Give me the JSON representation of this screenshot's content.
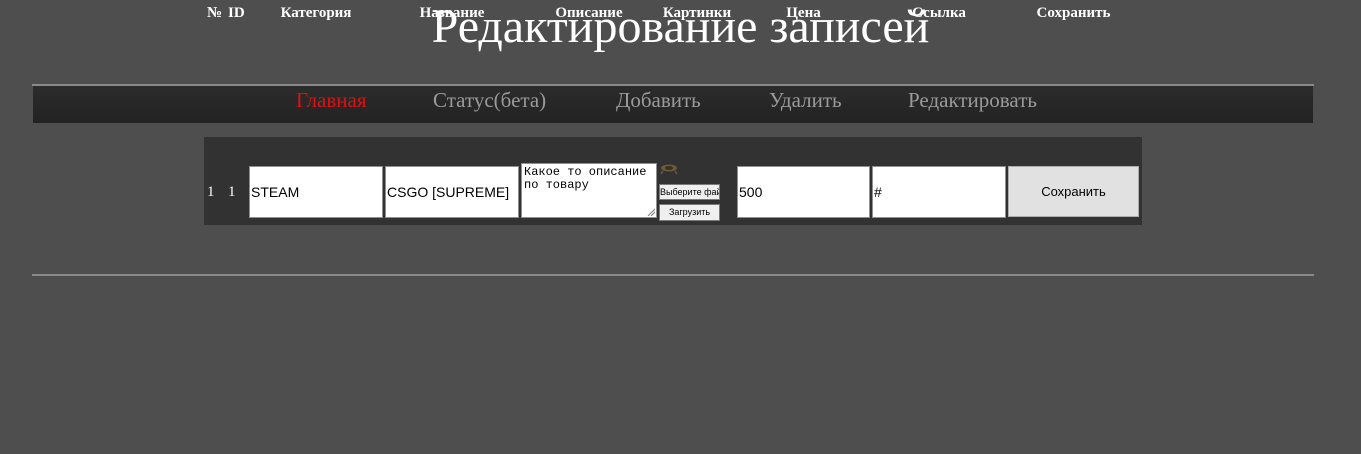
{
  "page": {
    "title": "Редактирование записей"
  },
  "nav": {
    "items": [
      {
        "label": "Главная",
        "active": true
      },
      {
        "label": "Статус(бета)",
        "active": false
      },
      {
        "label": "Добавить",
        "active": false
      },
      {
        "label": "Удалить",
        "active": false
      },
      {
        "label": "Редактировать",
        "active": false
      }
    ],
    "active_color": "#e01010",
    "inactive_color": "#9a9a9a"
  },
  "table": {
    "headers": [
      "№",
      "ID",
      "Категория",
      "Название",
      "Описание",
      "Картинки",
      "Цена",
      "Ссылка",
      "Сохранить"
    ],
    "rows": [
      {
        "num": "1",
        "id": "1",
        "category": "STEAM",
        "name": "CSGO [SUPREME]",
        "description": "Какое то описание по товару",
        "choose_file_label": "Выберите файл",
        "upload_label": "Загрузить",
        "price": "500",
        "link": "#",
        "save_label": "Сохранить"
      }
    ]
  },
  "colors": {
    "background": "#4e4e4e",
    "navbar": "#262626",
    "table_bg": "#323232"
  }
}
